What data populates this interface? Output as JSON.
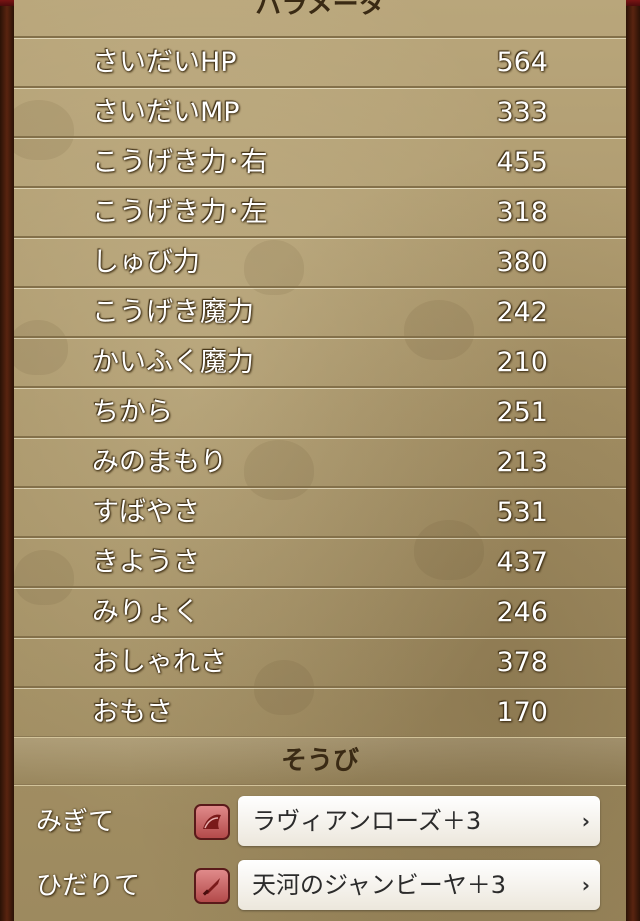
{
  "parameters": {
    "header": "パラメータ",
    "rows": [
      {
        "label": "さいだいHP",
        "value": "564"
      },
      {
        "label": "さいだいMP",
        "value": "333"
      },
      {
        "label": "こうげき力･右",
        "value": "455"
      },
      {
        "label": "こうげき力･左",
        "value": "318"
      },
      {
        "label": "しゅび力",
        "value": "380"
      },
      {
        "label": "こうげき魔力",
        "value": "242"
      },
      {
        "label": "かいふく魔力",
        "value": "210"
      },
      {
        "label": "ちから",
        "value": "251"
      },
      {
        "label": "みのまもり",
        "value": "213"
      },
      {
        "label": "すばやさ",
        "value": "531"
      },
      {
        "label": "きようさ",
        "value": "437"
      },
      {
        "label": "みりょく",
        "value": "246"
      },
      {
        "label": "おしゃれさ",
        "value": "378"
      },
      {
        "label": "おもさ",
        "value": "170"
      }
    ]
  },
  "equipment": {
    "header": "そうび",
    "slots": [
      {
        "slot": "みぎて",
        "icon": "fan-icon",
        "item": "ラヴィアンローズ＋3"
      },
      {
        "slot": "ひだりて",
        "icon": "knife-icon",
        "item": "天河のジャンビーヤ＋3"
      }
    ]
  },
  "colors": {
    "parchment": "#a89468",
    "frame": "#5a2410",
    "text": "#ffffff",
    "icon_bg": "#c45a5a"
  }
}
